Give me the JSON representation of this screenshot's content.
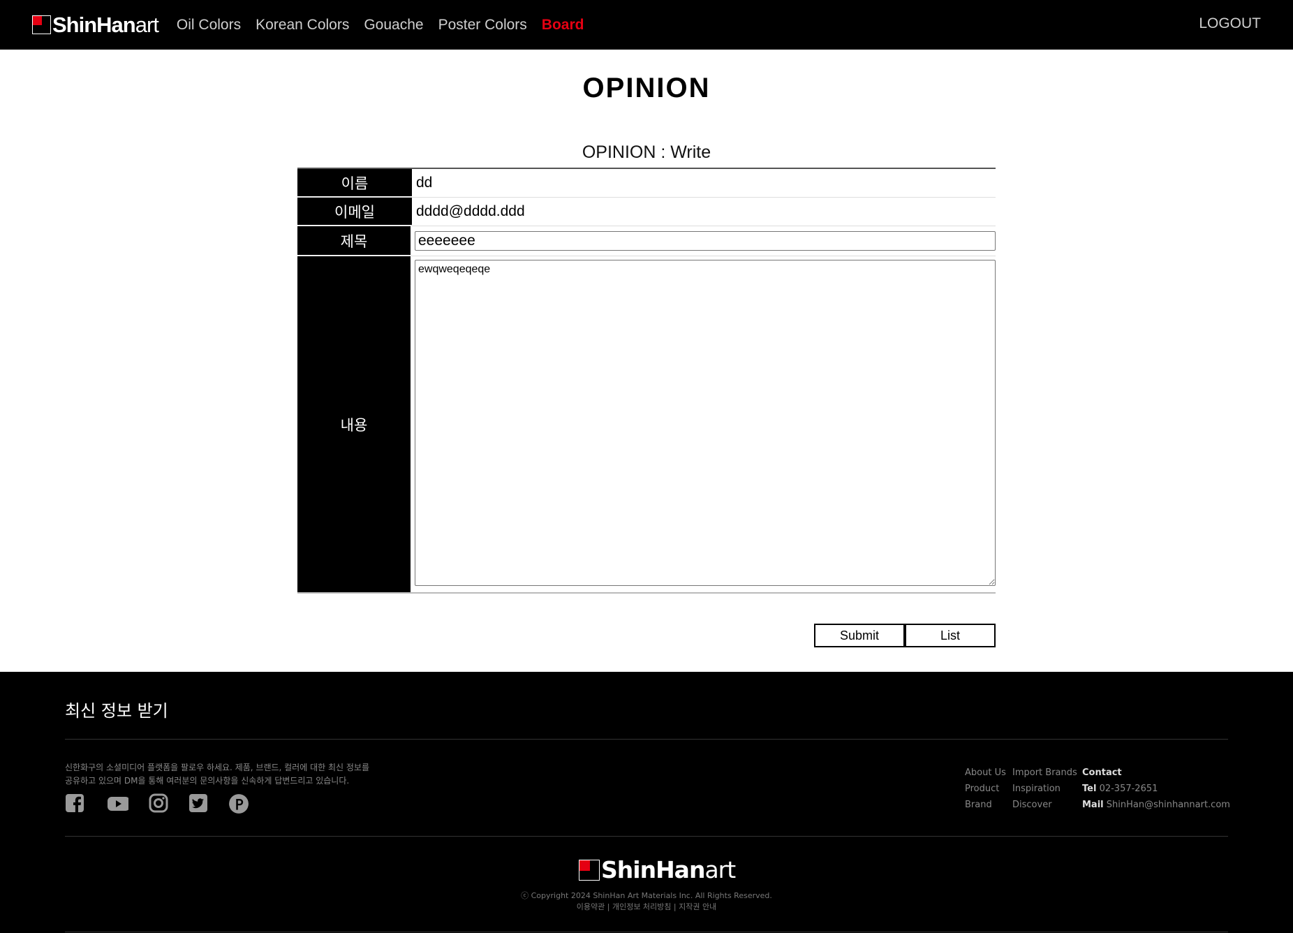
{
  "header": {
    "logo_bold": "ShinHan",
    "logo_light": "art",
    "nav": [
      {
        "label": "Oil Colors",
        "active": false
      },
      {
        "label": "Korean Colors",
        "active": false
      },
      {
        "label": "Gouache",
        "active": false
      },
      {
        "label": "Poster Colors",
        "active": false
      },
      {
        "label": "Board",
        "active": true
      }
    ],
    "logout_label": "LOGOUT"
  },
  "main": {
    "page_title": "OPINION",
    "sub_title": "OPINION : Write",
    "form": {
      "name_label": "이름",
      "name_value": "dd",
      "email_label": "이메일",
      "email_value": "dddd@dddd.ddd",
      "subject_label": "제목",
      "subject_value": "eeeeeee",
      "content_label": "내용",
      "content_value": "ewqweqeqeqe"
    },
    "submit_label": "Submit",
    "list_label": "List"
  },
  "footer": {
    "heading": "최신 정보 받기",
    "desc_line1": "신한화구의 소셜미디어 플랫폼을 팔로우 하세요. 제품, 브랜드, 컬러에 대한 최신 정보를",
    "desc_line2": "공유하고 있으며 DM을 통해 여러분의 문의사항을 신속하게 답변드리고 있습니다.",
    "socials": [
      "facebook-icon",
      "youtube-icon",
      "instagram-icon",
      "twitter-icon",
      "pinterest-icon"
    ],
    "links_col1": [
      "About Us",
      "Product",
      "Brand"
    ],
    "links_col2": [
      "Import Brands",
      "Inspiration",
      "Discover"
    ],
    "contact_title": "Contact",
    "tel_label": "Tel",
    "tel_value": "02-357-2651",
    "mail_label": "Mail",
    "mail_value": "ShinHan@shinhannart.com",
    "logo_bold": "ShinHan",
    "logo_light": "art",
    "copyright": "ⓒ Copyright 2024 ShinHan Art Materials Inc. All Rights Reserved.",
    "legal": "이용약관 | 개인정보 처리방침 | 지작권 안내"
  },
  "colors": {
    "header_bg": "#000000",
    "accent": "#e50012",
    "footer_bg": "#000000"
  }
}
